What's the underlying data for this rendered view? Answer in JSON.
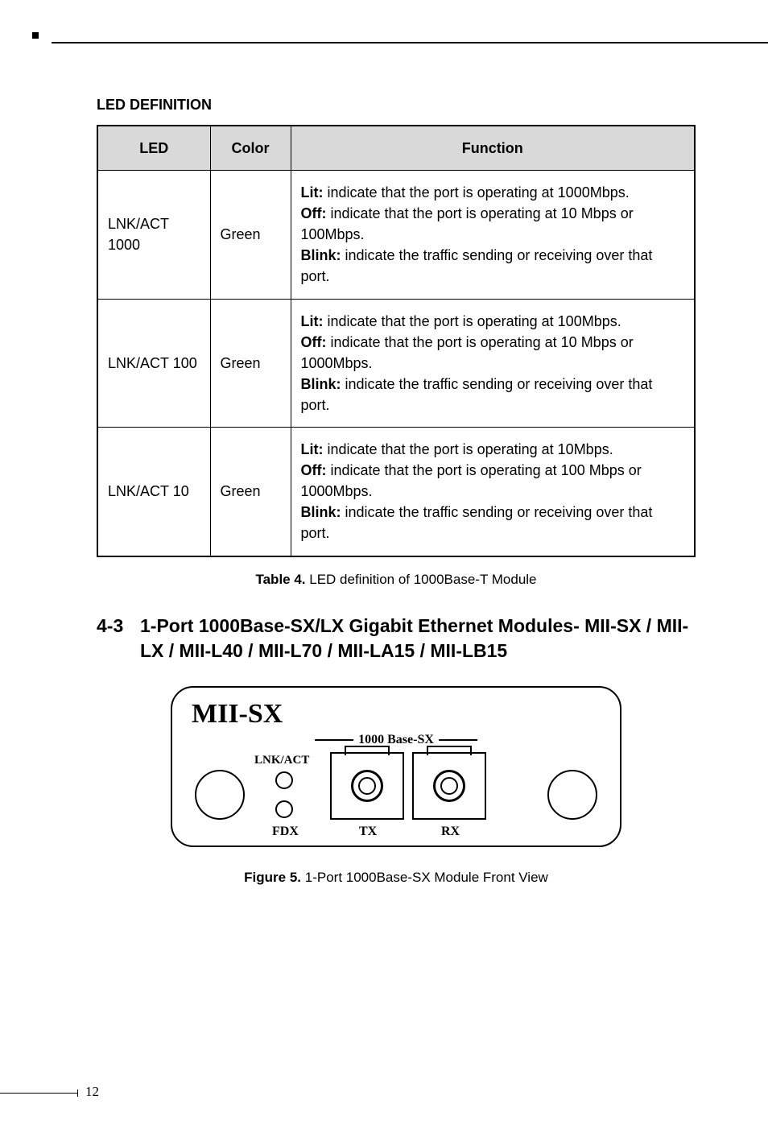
{
  "section_header": "LED DEFINITION",
  "table": {
    "headers": {
      "led": "LED",
      "color": "Color",
      "function": "Function"
    },
    "rows": [
      {
        "led": "LNK/ACT 1000",
        "color": "Green",
        "lit_label": "Lit:",
        "lit_text": " indicate that the port is operating at 1000Mbps.",
        "off_label": "Off:",
        "off_text": " indicate that the port is operating at 10 Mbps or 100Mbps.",
        "blink_label": "Blink:",
        "blink_text": " indicate the traffic sending or receiving over that port."
      },
      {
        "led": "LNK/ACT 100",
        "color": "Green",
        "lit_label": "Lit:",
        "lit_text": " indicate that the port is operating at 100Mbps.",
        "off_label": "Off:",
        "off_text": " indicate that the port is operating at 10 Mbps or 1000Mbps.",
        "blink_label": "Blink:",
        "blink_text": " indicate the traffic sending or receiving over that port."
      },
      {
        "led": "LNK/ACT 10",
        "color": "Green",
        "lit_label": "Lit:",
        "lit_text": " indicate that the port is operating at 10Mbps.",
        "off_label": "Off:",
        "off_text": " indicate that the port is operating at 100 Mbps or 1000Mbps.",
        "blink_label": "Blink:",
        "blink_text": " indicate the traffic sending or receiving over that port."
      }
    ]
  },
  "table_caption_bold": "Table 4.",
  "table_caption_text": "  LED definition of 1000Base-T Module",
  "heading_num": "4-3",
  "heading_text": "1-Port 1000Base-SX/LX Gigabit Ethernet Modules- MII-SX / MII-LX / MII-L40 / MII-L70 / MII-LA15 / MII-LB15",
  "module": {
    "name": "MII-SX",
    "label_1000": "1000 Base-SX",
    "lnk": "LNK/ACT",
    "fdx": "FDX",
    "tx": "TX",
    "rx": "RX"
  },
  "figure_caption_bold": "Figure 5.",
  "figure_caption_text": "  1-Port 1000Base-SX Module Front View",
  "page_number": "12"
}
